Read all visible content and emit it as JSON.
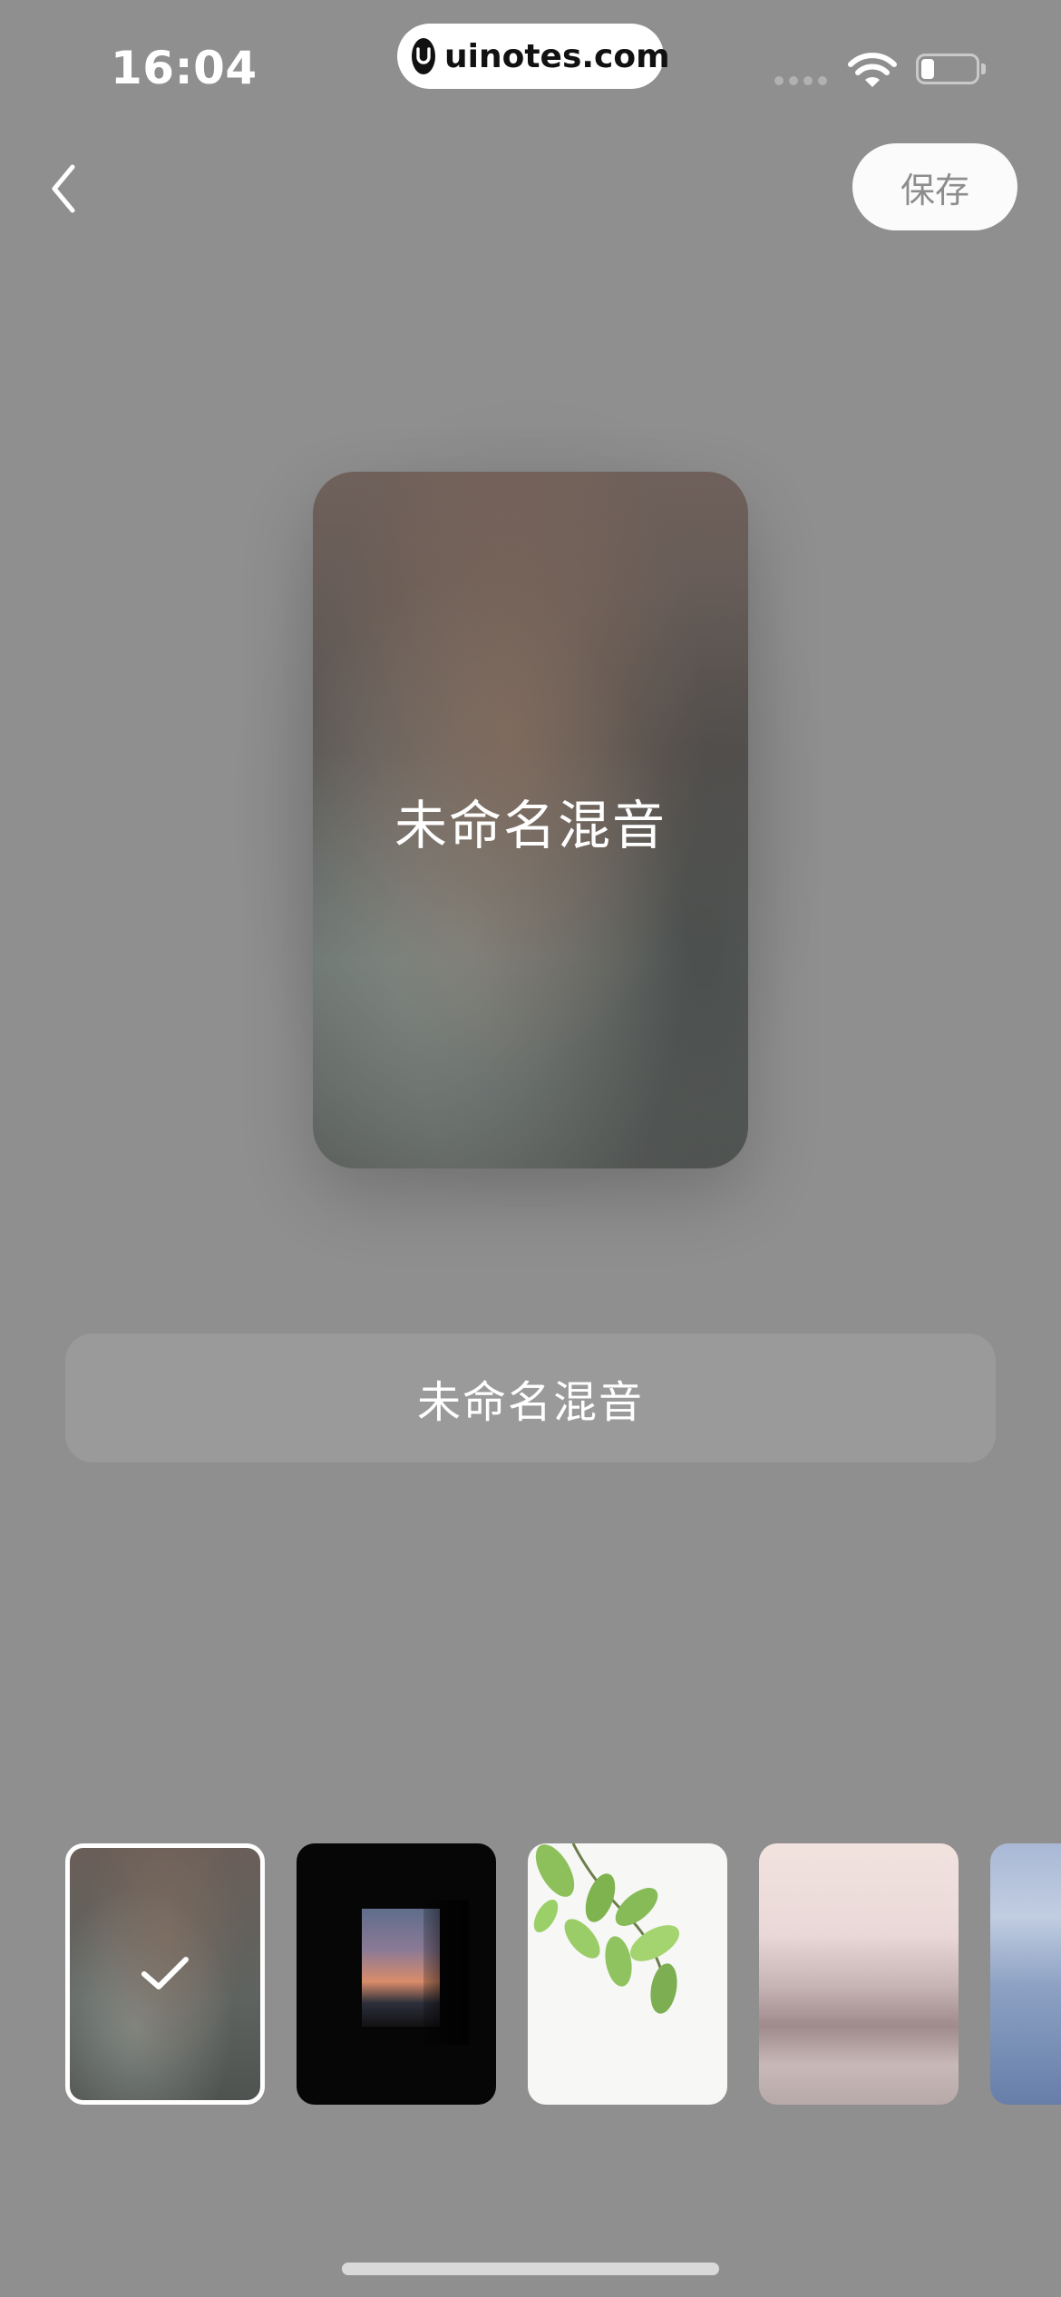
{
  "status_bar": {
    "time": "16:04",
    "watermark": "uinotes.com"
  },
  "nav": {
    "back_icon": "chevron-left-icon",
    "save_label": "保存"
  },
  "cover": {
    "title": "未命名混音"
  },
  "name_field": {
    "value": "未命名混音"
  },
  "thumbnails": {
    "selected_index": 0,
    "items": [
      {
        "name": "blurred-default",
        "selected": true
      },
      {
        "name": "window-sunset",
        "selected": false
      },
      {
        "name": "green-leaves",
        "selected": false
      },
      {
        "name": "snowy-hills",
        "selected": false
      },
      {
        "name": "sea-sky",
        "selected": false
      }
    ]
  },
  "colors": {
    "background": "#8f8f8f",
    "save_button_bg": "#fbfbfb",
    "save_button_text": "#8d8d8d",
    "text_white": "#ffffff"
  }
}
